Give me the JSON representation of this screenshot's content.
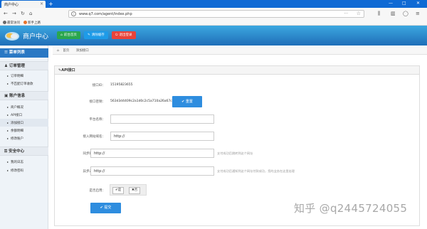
{
  "browser": {
    "tab_title": "商户中心",
    "tab_close": "×",
    "new_tab": "+",
    "url": "www.q7.com/agent/index.php",
    "url_more": "···",
    "window_min": "—",
    "window_max": "□",
    "window_close": "✕",
    "bookmarks": [
      {
        "label": "最常访问"
      },
      {
        "label": "新手上路"
      }
    ]
  },
  "header": {
    "brand": "商户中心",
    "buttons": [
      {
        "label": "前台首页",
        "color": "#2aa64e"
      },
      {
        "label": "清除缓存",
        "color": "#1e9be8"
      },
      {
        "label": "退出登录",
        "color": "#e8433a"
      }
    ]
  },
  "sidebar": {
    "main_title": "菜单列表",
    "groups": [
      {
        "title": "订单管理",
        "items": [
          "订单明细",
          "不匹配订单收款"
        ]
      },
      {
        "title": "账户信息",
        "items": [
          "商户概况",
          "API接口",
          "添加接口",
          "余额明细",
          "修改账户"
        ]
      },
      {
        "title": "安全中心",
        "items": [
          "我的日志",
          "修改密码"
        ]
      }
    ],
    "active_item": "添加接口"
  },
  "breadcrumb": {
    "home": "首页",
    "current": "添加接口"
  },
  "panel": {
    "title": "API接口",
    "fields": {
      "interface_id_label": "接口ID：",
      "interface_id_value": "15195823655",
      "secret_label": "接口密钥：",
      "secret_value": "563d3d4409c2a1d0c2c5a710a26a67c1",
      "reset_button": "重置",
      "platform_label": "平台名称：",
      "platform_value": "",
      "domain_label": "接入网站域名：",
      "domain_value": "http://",
      "sync_label": "同步跳转网址：",
      "sync_value": "http://",
      "sync_hint": "支付成功后跳转到这个网址",
      "async_label": "异步通知网址：",
      "async_value": "http://",
      "async_hint": "支付成功后通知到这个网址付款成功，您的业务在这里处理",
      "enabled_label": "是否启用：",
      "enabled_yes": "是",
      "enabled_no": "否",
      "submit_button": "提交"
    }
  },
  "watermark": "知乎 @q2445724055"
}
